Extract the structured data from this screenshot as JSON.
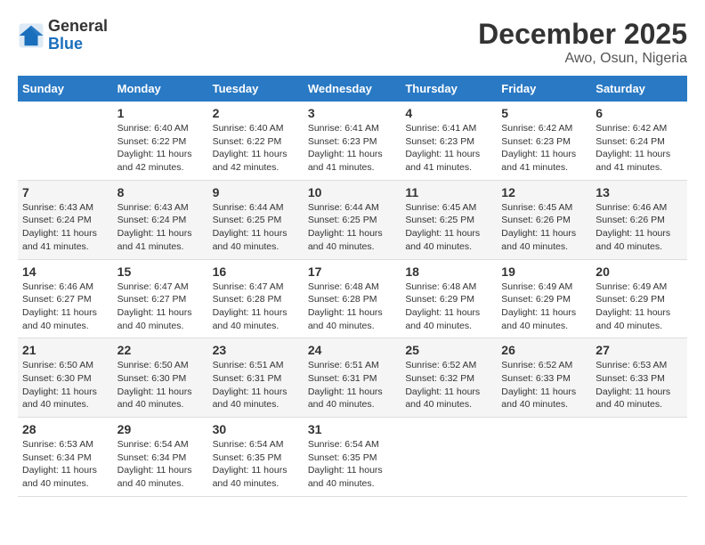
{
  "header": {
    "logo_general": "General",
    "logo_blue": "Blue",
    "month_title": "December 2025",
    "location": "Awo, Osun, Nigeria"
  },
  "days_of_week": [
    "Sunday",
    "Monday",
    "Tuesday",
    "Wednesday",
    "Thursday",
    "Friday",
    "Saturday"
  ],
  "weeks": [
    [
      {
        "day": "",
        "info": ""
      },
      {
        "day": "1",
        "info": "Sunrise: 6:40 AM\nSunset: 6:22 PM\nDaylight: 11 hours\nand 42 minutes."
      },
      {
        "day": "2",
        "info": "Sunrise: 6:40 AM\nSunset: 6:22 PM\nDaylight: 11 hours\nand 42 minutes."
      },
      {
        "day": "3",
        "info": "Sunrise: 6:41 AM\nSunset: 6:23 PM\nDaylight: 11 hours\nand 41 minutes."
      },
      {
        "day": "4",
        "info": "Sunrise: 6:41 AM\nSunset: 6:23 PM\nDaylight: 11 hours\nand 41 minutes."
      },
      {
        "day": "5",
        "info": "Sunrise: 6:42 AM\nSunset: 6:23 PM\nDaylight: 11 hours\nand 41 minutes."
      },
      {
        "day": "6",
        "info": "Sunrise: 6:42 AM\nSunset: 6:24 PM\nDaylight: 11 hours\nand 41 minutes."
      }
    ],
    [
      {
        "day": "7",
        "info": "Sunrise: 6:43 AM\nSunset: 6:24 PM\nDaylight: 11 hours\nand 41 minutes."
      },
      {
        "day": "8",
        "info": "Sunrise: 6:43 AM\nSunset: 6:24 PM\nDaylight: 11 hours\nand 41 minutes."
      },
      {
        "day": "9",
        "info": "Sunrise: 6:44 AM\nSunset: 6:25 PM\nDaylight: 11 hours\nand 40 minutes."
      },
      {
        "day": "10",
        "info": "Sunrise: 6:44 AM\nSunset: 6:25 PM\nDaylight: 11 hours\nand 40 minutes."
      },
      {
        "day": "11",
        "info": "Sunrise: 6:45 AM\nSunset: 6:25 PM\nDaylight: 11 hours\nand 40 minutes."
      },
      {
        "day": "12",
        "info": "Sunrise: 6:45 AM\nSunset: 6:26 PM\nDaylight: 11 hours\nand 40 minutes."
      },
      {
        "day": "13",
        "info": "Sunrise: 6:46 AM\nSunset: 6:26 PM\nDaylight: 11 hours\nand 40 minutes."
      }
    ],
    [
      {
        "day": "14",
        "info": "Sunrise: 6:46 AM\nSunset: 6:27 PM\nDaylight: 11 hours\nand 40 minutes."
      },
      {
        "day": "15",
        "info": "Sunrise: 6:47 AM\nSunset: 6:27 PM\nDaylight: 11 hours\nand 40 minutes."
      },
      {
        "day": "16",
        "info": "Sunrise: 6:47 AM\nSunset: 6:28 PM\nDaylight: 11 hours\nand 40 minutes."
      },
      {
        "day": "17",
        "info": "Sunrise: 6:48 AM\nSunset: 6:28 PM\nDaylight: 11 hours\nand 40 minutes."
      },
      {
        "day": "18",
        "info": "Sunrise: 6:48 AM\nSunset: 6:29 PM\nDaylight: 11 hours\nand 40 minutes."
      },
      {
        "day": "19",
        "info": "Sunrise: 6:49 AM\nSunset: 6:29 PM\nDaylight: 11 hours\nand 40 minutes."
      },
      {
        "day": "20",
        "info": "Sunrise: 6:49 AM\nSunset: 6:29 PM\nDaylight: 11 hours\nand 40 minutes."
      }
    ],
    [
      {
        "day": "21",
        "info": "Sunrise: 6:50 AM\nSunset: 6:30 PM\nDaylight: 11 hours\nand 40 minutes."
      },
      {
        "day": "22",
        "info": "Sunrise: 6:50 AM\nSunset: 6:30 PM\nDaylight: 11 hours\nand 40 minutes."
      },
      {
        "day": "23",
        "info": "Sunrise: 6:51 AM\nSunset: 6:31 PM\nDaylight: 11 hours\nand 40 minutes."
      },
      {
        "day": "24",
        "info": "Sunrise: 6:51 AM\nSunset: 6:31 PM\nDaylight: 11 hours\nand 40 minutes."
      },
      {
        "day": "25",
        "info": "Sunrise: 6:52 AM\nSunset: 6:32 PM\nDaylight: 11 hours\nand 40 minutes."
      },
      {
        "day": "26",
        "info": "Sunrise: 6:52 AM\nSunset: 6:33 PM\nDaylight: 11 hours\nand 40 minutes."
      },
      {
        "day": "27",
        "info": "Sunrise: 6:53 AM\nSunset: 6:33 PM\nDaylight: 11 hours\nand 40 minutes."
      }
    ],
    [
      {
        "day": "28",
        "info": "Sunrise: 6:53 AM\nSunset: 6:34 PM\nDaylight: 11 hours\nand 40 minutes."
      },
      {
        "day": "29",
        "info": "Sunrise: 6:54 AM\nSunset: 6:34 PM\nDaylight: 11 hours\nand 40 minutes."
      },
      {
        "day": "30",
        "info": "Sunrise: 6:54 AM\nSunset: 6:35 PM\nDaylight: 11 hours\nand 40 minutes."
      },
      {
        "day": "31",
        "info": "Sunrise: 6:54 AM\nSunset: 6:35 PM\nDaylight: 11 hours\nand 40 minutes."
      },
      {
        "day": "",
        "info": ""
      },
      {
        "day": "",
        "info": ""
      },
      {
        "day": "",
        "info": ""
      }
    ]
  ]
}
